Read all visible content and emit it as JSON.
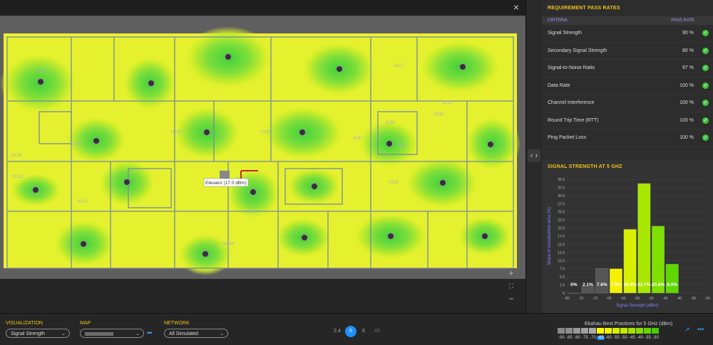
{
  "map": {
    "close_icon": "×",
    "elevator_label": "Elevator (17.0 dBm)",
    "room_labels": [
      "N134",
      "N140",
      "N132",
      "N129",
      "S125",
      "S127",
      "S129",
      "S136",
      "S147",
      "S150",
      "S152",
      "S154",
      "S104",
      "N136",
      "N124",
      "Nation"
    ],
    "zoom_in": "+",
    "fit": "⛶",
    "zoom_out": "−"
  },
  "divider": {
    "toggle_label": "‹ ›"
  },
  "requirements": {
    "title": "REQUIREMENT PASS RATES",
    "col_criteria": "CRITERIA",
    "col_pass_rate": "PASS RATE",
    "rows": [
      {
        "name": "Signal Strength",
        "value": "90  %"
      },
      {
        "name": "Secondary Signal Strength",
        "value": "80  %"
      },
      {
        "name": "Signal-to-Noise Ratio",
        "value": "97  %"
      },
      {
        "name": "Data Rate",
        "value": "100  %"
      },
      {
        "name": "Channel Interference",
        "value": "100  %"
      },
      {
        "name": "Round Trip Time (RTT)",
        "value": "100  %"
      },
      {
        "name": "Ping Packet Loss",
        "value": "100  %"
      }
    ],
    "check": "✓"
  },
  "signal_chart_title": "SIGNAL STRENGTH AT 5 GHZ",
  "chart_data": {
    "type": "bar",
    "title": "SIGNAL STRENGTH AT 5 GHZ",
    "xlabel": "Signal Strength (dBm)",
    "ylabel": "Share of visualization area (%)",
    "x_ticks": [
      "-80",
      "-75",
      "-70",
      "-65",
      "-60",
      "-55",
      "-50",
      "-45",
      "-40",
      "-35",
      "-30"
    ],
    "y_ticks": [
      "0",
      "2.5",
      "5.0",
      "7.5",
      "10.0",
      "12.5",
      "15.0",
      "17.5",
      "20.0",
      "22.5",
      "25.0",
      "27.5",
      "30.0",
      "32.5",
      "35.0"
    ],
    "ylim": [
      0,
      35
    ],
    "categories": [
      "-80 to -75",
      "-75 to -70",
      "-70 to -65",
      "-65 to -60",
      "-60 to -55",
      "-55 to -50",
      "-50 to -45",
      "-45 to -40"
    ],
    "values": [
      0,
      2.1,
      7.6,
      7.5,
      19.6,
      33.7,
      20.6,
      8.9
    ],
    "labels": [
      "0%",
      "2.1%",
      "7.6%",
      "7.5%",
      "19.6%",
      "33.7%",
      "20.6%",
      "8.9%"
    ],
    "colors": [
      "#3a3a3a",
      "#555555",
      "#555555",
      "#f4f000",
      "#d8f000",
      "#a8e800",
      "#7fe000",
      "#5ed800"
    ]
  },
  "bottom": {
    "visualization_label": "VISUALIZATION",
    "visualization_value": "Signal Strength",
    "map_label": "MAP",
    "map_value": "",
    "network_label": "NETWORK",
    "network_value": "All Simulated",
    "more": "•••",
    "bands": [
      "2.4",
      "5",
      "6",
      "All"
    ],
    "legend_title": "Ekahau Best Practices for 5 GHz (dBm)",
    "legend_values": [
      "-90",
      "-85",
      "-80",
      "-75",
      "-70",
      "-65",
      "-60",
      "-55",
      "-50",
      "-45",
      "-40",
      "-35",
      "-30"
    ],
    "legend_colors": [
      "#888888",
      "#8d8d8d",
      "#999999",
      "#a0a0a0",
      "#aaaaaa",
      "#ffff00",
      "#f0f400",
      "#d8ef00",
      "#c0ea00",
      "#a2e300",
      "#84dc00",
      "#66d400",
      "#48cc00"
    ],
    "external_icon": "↗",
    "more_icon": "•••"
  }
}
